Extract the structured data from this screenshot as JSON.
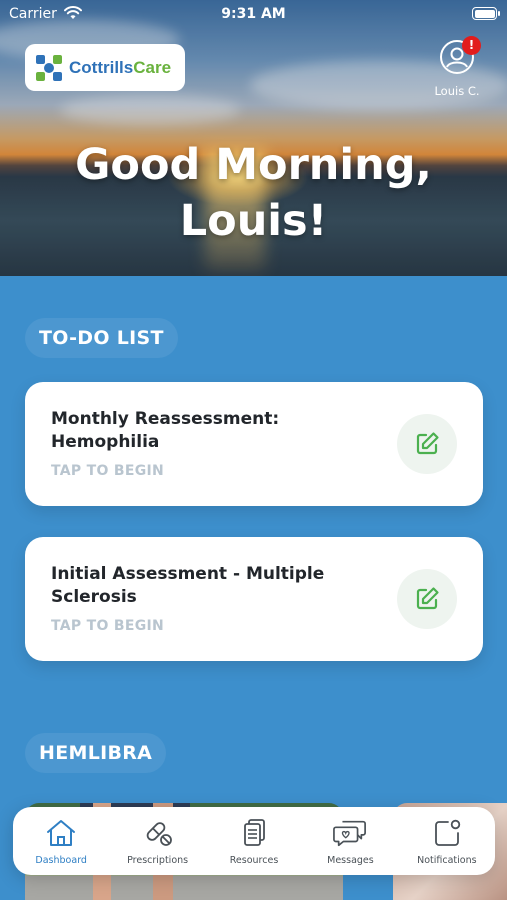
{
  "status_bar": {
    "carrier": "Carrier",
    "time": "9:31 AM"
  },
  "header": {
    "logo_text_part1": "Cottrills",
    "logo_text_part2": "Care",
    "profile_name": "Louis C.",
    "notification_badge": "!",
    "greeting_line1": "Good Morning,",
    "greeting_line2": "Louis!"
  },
  "todo": {
    "heading": "TO-DO LIST",
    "items": [
      {
        "title": "Monthly Reassessment: Hemophilia",
        "subtitle": "TAP TO BEGIN"
      },
      {
        "title": "Initial Assessment - Multiple Sclerosis",
        "subtitle": "TAP TO BEGIN"
      }
    ]
  },
  "featured": {
    "heading": "HEMLIBRA"
  },
  "tab_bar": {
    "tabs": [
      {
        "label": "Dashboard",
        "icon": "home-icon",
        "active": true
      },
      {
        "label": "Prescriptions",
        "icon": "pill-icon",
        "active": false
      },
      {
        "label": "Resources",
        "icon": "documents-icon",
        "active": false
      },
      {
        "label": "Messages",
        "icon": "chat-icon",
        "active": false
      },
      {
        "label": "Notifications",
        "icon": "notification-icon",
        "active": false
      }
    ]
  },
  "colors": {
    "background": "#3d8fcc",
    "accent_blue": "#2f7fc4",
    "accent_green": "#6ab23e",
    "badge_red": "#e21c1c"
  }
}
